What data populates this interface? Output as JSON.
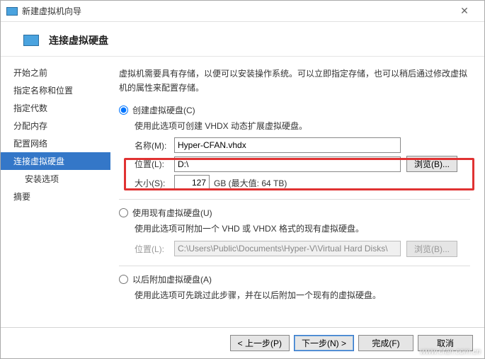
{
  "window": {
    "title": "新建虚拟机向导"
  },
  "header": {
    "title": "连接虚拟硬盘"
  },
  "sidebar": {
    "steps": [
      "开始之前",
      "指定名称和位置",
      "指定代数",
      "分配内存",
      "配置网络",
      "连接虚拟硬盘",
      "安装选项",
      "摘要"
    ],
    "active_index": 5,
    "indent_indices": [
      6
    ]
  },
  "content": {
    "description": "虚拟机需要具有存储，以便可以安装操作系统。可以立即指定存储，也可以稍后通过修改虚拟机的属性来配置存储。",
    "opt_create": {
      "label": "创建虚拟硬盘(C)",
      "hint": "使用此选项可创建 VHDX 动态扩展虚拟硬盘。",
      "name_label": "名称(M):",
      "name_value": "Hyper-CFAN.vhdx",
      "loc_label": "位置(L):",
      "loc_value": "D:\\",
      "browse_label": "浏览(B)...",
      "size_label": "大小(S):",
      "size_value": "127",
      "size_suffix": "GB (最大值: 64 TB)"
    },
    "opt_existing": {
      "label": "使用现有虚拟硬盘(U)",
      "hint": "使用此选项可附加一个 VHD 或 VHDX 格式的现有虚拟硬盘。",
      "loc_label": "位置(L):",
      "loc_value": "C:\\Users\\Public\\Documents\\Hyper-V\\Virtual Hard Disks\\",
      "browse_label": "浏览(B)..."
    },
    "opt_later": {
      "label": "以后附加虚拟硬盘(A)",
      "hint": "使用此选项可先跳过此步骤，并在以后附加一个现有的虚拟硬盘。"
    }
  },
  "footer": {
    "prev": "< 上一步(P)",
    "next": "下一步(N) >",
    "finish": "完成(F)",
    "cancel": "取消"
  },
  "watermark": "www.cfan.com.cn"
}
